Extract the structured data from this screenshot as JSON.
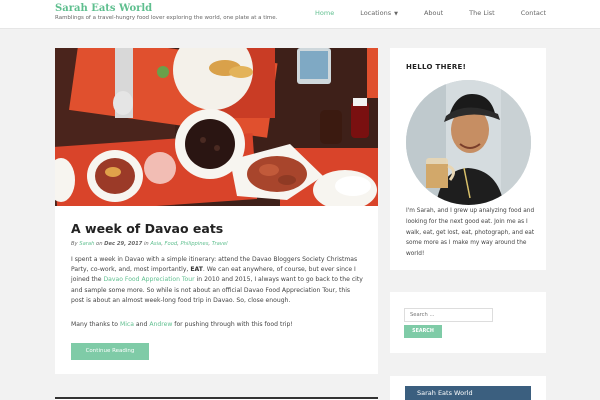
{
  "site": {
    "title": "Sarah Eats World",
    "tagline": "Ramblings of a travel-hungry food lover exploring the world, one plate at a time."
  },
  "nav": {
    "items": [
      {
        "label": "Home",
        "active": true
      },
      {
        "label": "Locations",
        "has_dropdown": true
      },
      {
        "label": "About"
      },
      {
        "label": "The List"
      },
      {
        "label": "Contact"
      }
    ]
  },
  "post": {
    "title": "A week of Davao eats",
    "meta": {
      "by": "By",
      "author": "Sarah",
      "on": "on",
      "date": "Dec 29, 2017",
      "in": "in",
      "categories": [
        "Asia",
        "Food",
        "Philippines",
        "Travel"
      ]
    },
    "paragraph": {
      "part1": "I spent a week in Davao with a simple itinerary: attend the Davao Bloggers Society Christmas Party, co-work, and, most importantly, ",
      "bold": "EAT",
      "part2": ". We can eat anywhere, of course, but ever since I joined the ",
      "link": "Davao Food Appreciation Tour",
      "part3": " in 2010 and 2015, I always want to go back to the city and sample some more. So while is not about an official Davao Food Appreciation Tour, this post is about an almost week-long food trip in Davao. So, close enough."
    },
    "thanks": {
      "part1": "Many thanks to ",
      "name1": "Mica",
      "and": " and ",
      "name2": "Andrew",
      "part2": " for pushing through with this food trip!"
    },
    "continue_label": "Continue Reading"
  },
  "sidebar": {
    "hello_title": "HELLO THERE!",
    "about": "I'm Sarah, and I grew up analyzing food and looking for the next good eat. Join me as I walk, eat, get lost, eat, photograph, and eat some more as I make my way around the world!",
    "search_placeholder": "Search ...",
    "search_button": "SEARCH",
    "thumb_label": "Sarah Eats World"
  },
  "colors": {
    "accent": "#5fbf8f",
    "button": "#7fcba7",
    "background": "#f2f2f2"
  }
}
